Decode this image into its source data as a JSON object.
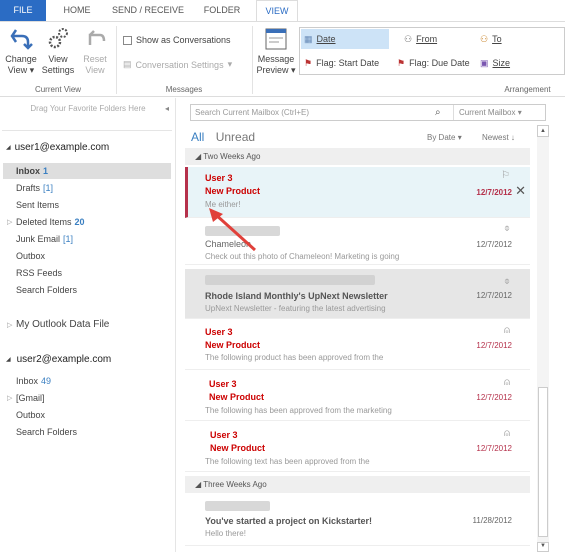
{
  "tabs": [
    {
      "label": "FILE"
    },
    {
      "label": "HOME"
    },
    {
      "label": "SEND / RECEIVE"
    },
    {
      "label": "FOLDER"
    },
    {
      "label": "VIEW"
    }
  ],
  "ribbon": {
    "current_view": {
      "group_label": "Current View",
      "change_view": "Change View",
      "view_settings": "View Settings",
      "reset_view": "Reset View"
    },
    "messages": {
      "group_label": "Messages",
      "show_as_conversations": "Show as Conversations",
      "conversation_settings": "Conversation Settings"
    },
    "message_preview": "Message Preview",
    "arrangement": {
      "group_label": "Arrangement",
      "items": [
        {
          "label": "Date",
          "selected": true
        },
        {
          "label": "From"
        },
        {
          "label": "To"
        },
        {
          "label": "Flag: Start Date"
        },
        {
          "label": "Flag: Due Date"
        },
        {
          "label": "Size"
        }
      ]
    }
  },
  "left_pane": {
    "favorites_hint": "Drag Your Favorite Folders Here",
    "account1": {
      "email": "user1@example.com",
      "folders": [
        {
          "name": "Inbox",
          "count": "1",
          "selected": true
        },
        {
          "name": "Drafts",
          "count": "[1]"
        },
        {
          "name": "Sent Items",
          "count": ""
        },
        {
          "name": "Deleted Items",
          "count": "20"
        },
        {
          "name": "Junk Email",
          "count": "[1]"
        },
        {
          "name": "Outbox",
          "count": ""
        },
        {
          "name": "RSS Feeds",
          "count": ""
        },
        {
          "name": "Search Folders",
          "count": ""
        }
      ]
    },
    "data_file": "My Outlook Data File",
    "account2": {
      "email": "user2@example.com",
      "folders": [
        {
          "name": "Inbox",
          "count": "49"
        },
        {
          "name": "[Gmail]",
          "count": ""
        },
        {
          "name": "Outbox",
          "count": ""
        },
        {
          "name": "Search Folders",
          "count": ""
        }
      ]
    }
  },
  "message_list": {
    "search_placeholder": "Search Current Mailbox (Ctrl+E)",
    "search_scope": "Current Mailbox",
    "filter_all": "All",
    "filter_unread": "Unread",
    "sort_by": "By Date",
    "sort_order": "Newest",
    "groups": [
      {
        "label": "Two Weeks Ago",
        "messages": [
          {
            "from": "User 3",
            "subject": "New Product",
            "preview": "Me either!",
            "date": "12/7/2012"
          },
          {
            "from": "",
            "subject": "Chameleon",
            "preview": "Check out this photo of Chameleon! Marketing is going",
            "date": "12/7/2012"
          },
          {
            "from": "",
            "subject": "Rhode Island Monthly's UpNext Newsletter",
            "preview": "UpNext Newsletter - featuring the latest advertising",
            "date": "12/7/2012"
          },
          {
            "from": "User 3",
            "subject": "New Product",
            "preview": "The following product has been approved from the",
            "date": "12/7/2012"
          },
          {
            "from": "User 3",
            "subject": "New Product",
            "preview": "The following has been approved from the marketing",
            "date": "12/7/2012"
          },
          {
            "from": "User 3",
            "subject": "New Product",
            "preview": "The following text has been approved from the",
            "date": "12/7/2012"
          }
        ]
      },
      {
        "label": "Three Weeks Ago",
        "messages": [
          {
            "from": "",
            "subject": "You've started a project on Kickstarter!",
            "preview": "Hello there!",
            "date": "11/28/2012"
          }
        ]
      }
    ]
  },
  "colors": {
    "accent": "#2b6cc4",
    "unread_red": "#cc0000",
    "selected_bar": "#b5314b",
    "selected_bg": "#e8f4f8",
    "annotation_arrow": "#e0403a"
  }
}
